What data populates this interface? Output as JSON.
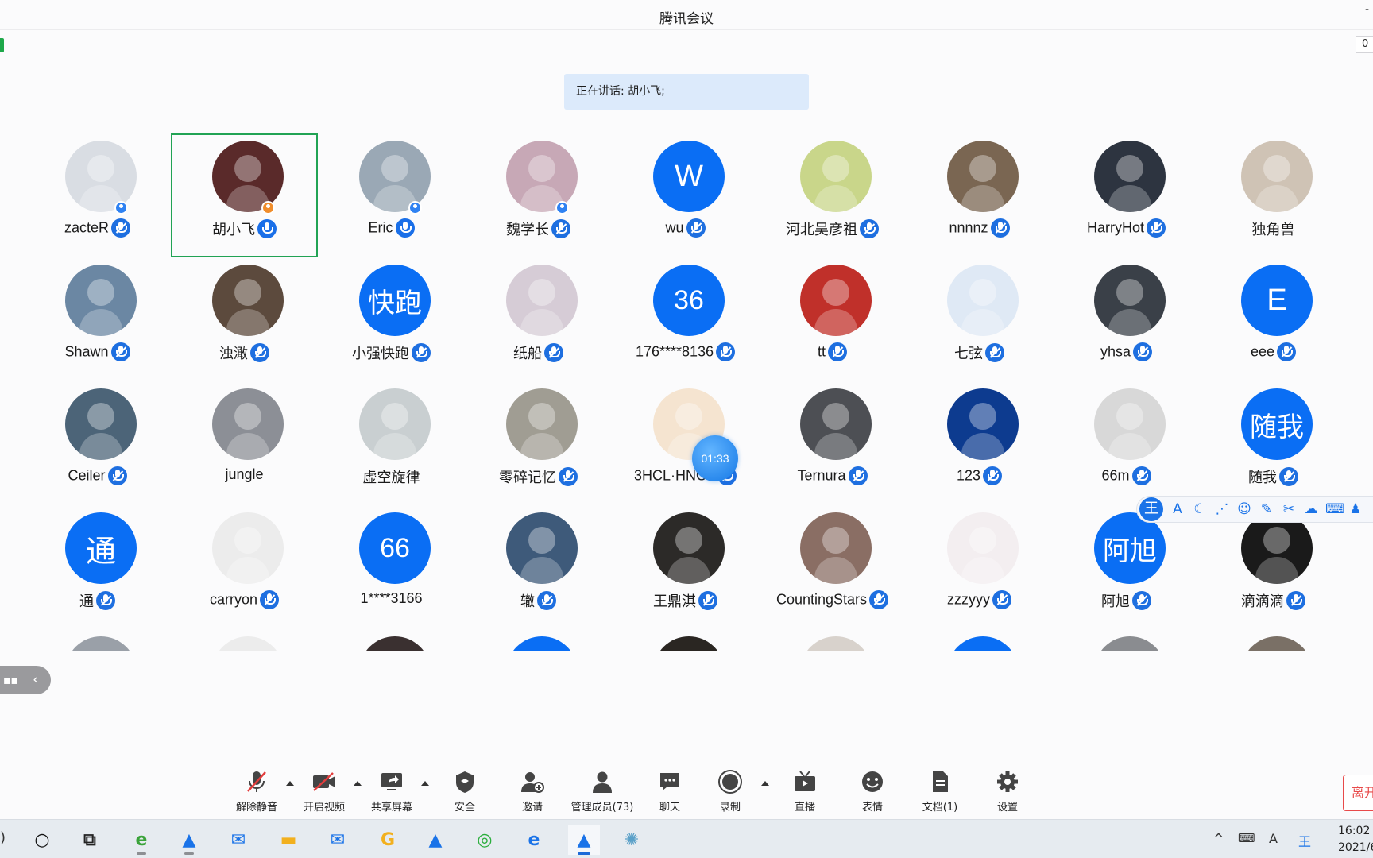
{
  "window": {
    "title": "腾讯会议",
    "minimize_glyph": "-"
  },
  "infobar": {
    "timer_partial": "0"
  },
  "speaking": {
    "label": "正在讲话:",
    "speaker": "胡小飞;"
  },
  "participants": [
    {
      "name": "zacteR",
      "avatar_kind": "image",
      "avatar_color": "#d9dde3",
      "host_badge": "blue",
      "mic": "muted"
    },
    {
      "name": "胡小飞",
      "avatar_kind": "image",
      "avatar_color": "#5a2a2a",
      "host_badge": "orange",
      "mic": "on",
      "active": true
    },
    {
      "name": "Eric",
      "avatar_kind": "image",
      "avatar_color": "#9aa8b5",
      "host_badge": "blue",
      "mic": "on"
    },
    {
      "name": "魏学长",
      "avatar_kind": "image",
      "avatar_color": "#c7a8b6",
      "host_badge": "blue",
      "mic": "muted"
    },
    {
      "name": "wu",
      "avatar_kind": "text",
      "avatar_text": "W",
      "mic": "muted"
    },
    {
      "name": "河北吴彦祖",
      "avatar_kind": "image",
      "avatar_color": "#c9d68a",
      "mic": "muted"
    },
    {
      "name": "nnnnz",
      "avatar_kind": "image",
      "avatar_color": "#7a6652",
      "mic": "muted"
    },
    {
      "name": "HarryHot",
      "avatar_kind": "image",
      "avatar_color": "#2d3440",
      "mic": "muted"
    },
    {
      "name": "独角兽",
      "avatar_kind": "image",
      "avatar_color": "#cfc3b5",
      "mic": "none"
    },
    {
      "name": "Shawn",
      "avatar_kind": "image",
      "avatar_color": "#6b87a3",
      "mic": "muted"
    },
    {
      "name": "浊澉",
      "avatar_kind": "image",
      "avatar_color": "#5c4a3d",
      "mic": "muted"
    },
    {
      "name": "小强快跑",
      "avatar_kind": "text",
      "avatar_text": "快跑",
      "mic": "muted"
    },
    {
      "name": "纸船",
      "avatar_kind": "image",
      "avatar_color": "#d6ccd6",
      "mic": "muted"
    },
    {
      "name": "176****8136",
      "avatar_kind": "text",
      "avatar_text": "36",
      "mic": "muted"
    },
    {
      "name": "tt",
      "avatar_kind": "image",
      "avatar_color": "#c0302a",
      "mic": "muted"
    },
    {
      "name": "七弦",
      "avatar_kind": "image",
      "avatar_color": "#dfe9f5",
      "mic": "muted"
    },
    {
      "name": "yhsa",
      "avatar_kind": "image",
      "avatar_color": "#3a4048",
      "mic": "muted"
    },
    {
      "name": "eee",
      "avatar_kind": "text",
      "avatar_text": "E",
      "mic": "muted"
    },
    {
      "name": "Ceiler",
      "avatar_kind": "image",
      "avatar_color": "#4c6478",
      "mic": "muted"
    },
    {
      "name": "jungle",
      "avatar_kind": "image",
      "avatar_color": "#8c8f96",
      "mic": "none"
    },
    {
      "name": "虚空旋律",
      "avatar_kind": "image",
      "avatar_color": "#c9cfd1",
      "mic": "none"
    },
    {
      "name": "零碎记忆",
      "avatar_kind": "image",
      "avatar_color": "#a09d93",
      "mic": "muted"
    },
    {
      "name": "3HCL·HNO3",
      "avatar_kind": "image",
      "avatar_color": "#f5e4d0",
      "mic": "muted"
    },
    {
      "name": "Ternura",
      "avatar_kind": "image",
      "avatar_color": "#4d4f54",
      "mic": "muted"
    },
    {
      "name": "123",
      "avatar_kind": "image",
      "avatar_color": "#0d3b8f",
      "mic": "muted"
    },
    {
      "name": "66m",
      "avatar_kind": "image",
      "avatar_color": "#d8d8d8",
      "mic": "muted"
    },
    {
      "name": "随我",
      "avatar_kind": "text",
      "avatar_text": "随我",
      "mic": "muted"
    },
    {
      "name": "通",
      "avatar_kind": "text",
      "avatar_text": "通",
      "mic": "muted"
    },
    {
      "name": "carryon",
      "avatar_kind": "image",
      "avatar_color": "#ececec",
      "mic": "muted"
    },
    {
      "name": "1****3166",
      "avatar_kind": "text",
      "avatar_text": "66",
      "mic": "none"
    },
    {
      "name": "辙",
      "avatar_kind": "image",
      "avatar_color": "#3e5a7a",
      "mic": "muted"
    },
    {
      "name": "王鼎淇",
      "avatar_kind": "image",
      "avatar_color": "#2c2a28",
      "mic": "muted"
    },
    {
      "name": "CountingStars",
      "avatar_kind": "image",
      "avatar_color": "#8a6e64",
      "mic": "muted"
    },
    {
      "name": "zzzyyy",
      "avatar_kind": "image",
      "avatar_color": "#f3eef0",
      "mic": "muted"
    },
    {
      "name": "阿旭",
      "avatar_kind": "text",
      "avatar_text": "阿旭",
      "mic": "muted"
    },
    {
      "name": "滴滴滴",
      "avatar_kind": "image",
      "avatar_color": "#1a1a1a",
      "mic": "muted"
    }
  ],
  "partial_row_colors": [
    "#9aa0a8",
    "#ececec",
    "#3a3030",
    "#0a6ef4",
    "#2a2622",
    "#d8d2cc",
    "#0a6ef4",
    "#8a8c90",
    "#7a7066"
  ],
  "call_bubble": {
    "time": "01:33"
  },
  "ime": {
    "logo": "王",
    "icons": [
      "A",
      "☾",
      "⋰",
      "☺",
      "✎",
      "✂",
      "☁",
      "⌨",
      "♟"
    ]
  },
  "drawer": {
    "icon": "chat-icon",
    "chevron": "‹"
  },
  "toolbar": {
    "unmute": "解除静音",
    "start_video": "开启视频",
    "share_screen": "共享屏幕",
    "security": "安全",
    "invite": "邀请",
    "manage_members": "管理成员(73)",
    "chat": "聊天",
    "record": "录制",
    "live": "直播",
    "emoji": "表情",
    "docs": "文档(1)",
    "settings": "设置",
    "leave_partial": "离开"
  },
  "taskbar": {
    "clock_time": "16:02",
    "clock_date": "2021/6/",
    "apps": [
      "cortana-icon",
      "task-view-icon",
      "ie-icon",
      "tencent-meeting-icon",
      "lark-icon",
      "file-explorer-icon",
      "mail-icon",
      "app-g-icon",
      "tencent-meeting-icon-2",
      "wechat-icon",
      "edge-icon",
      "tencent-meeting-active-icon",
      "app-swirl-icon"
    ]
  },
  "colors": {
    "accent": "#0a6ef4",
    "active_outline": "#21a354",
    "leave": "#e84a4a"
  }
}
